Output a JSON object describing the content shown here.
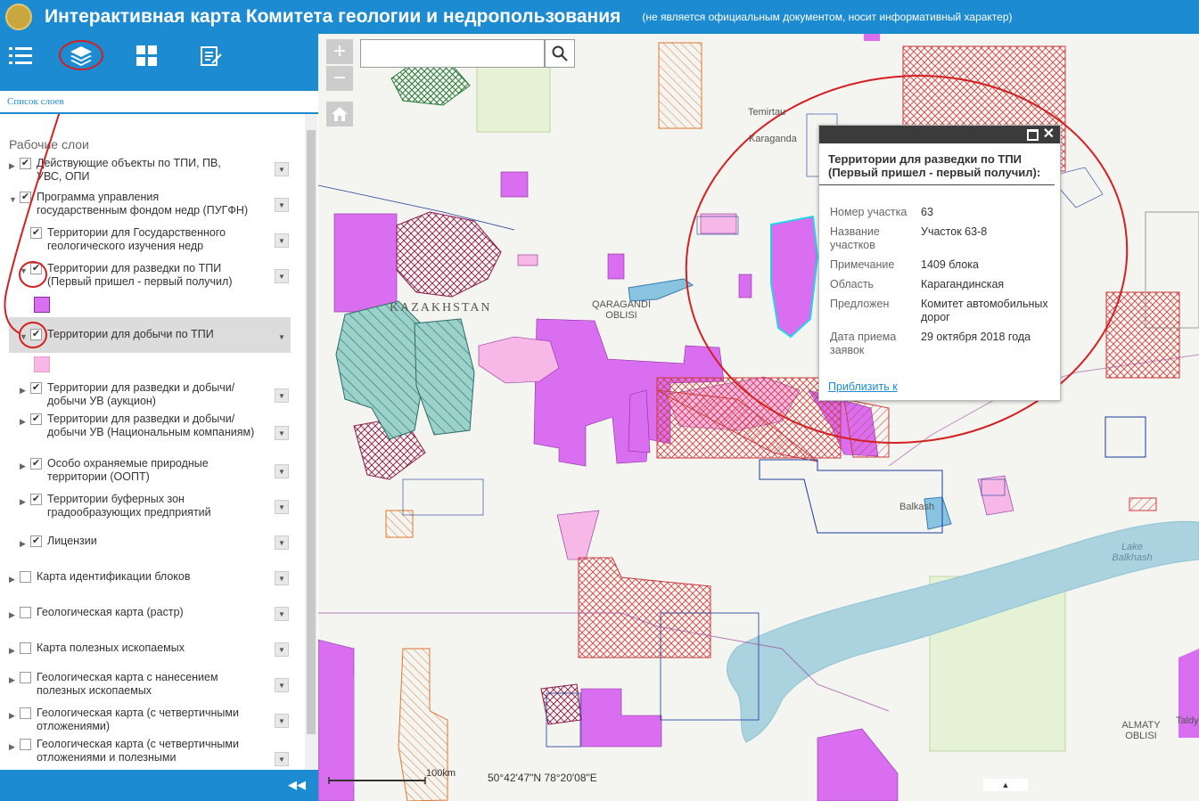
{
  "header": {
    "title": "Интерактивная карта Комитета геологии и недропользования",
    "subtitle": "(не является официальным документом, носит информативный характер)"
  },
  "toolbar": {
    "tools": [
      "list-icon",
      "layers-icon",
      "basemap-gallery-icon",
      "edit-icon"
    ]
  },
  "panel": {
    "tab_label": "Список слоев",
    "section_title": "Рабочие слои"
  },
  "layers": [
    {
      "label": "Действующие объекты по ТПИ, ПВ, УВС, ОПИ",
      "checked": true
    },
    {
      "label": "Программа управления государственным фондом недр (ПУГФН)",
      "checked": true
    },
    {
      "label": "Территории для Государственного геологического изучения недр",
      "checked": true
    },
    {
      "label": "Территории для разведки по ТПИ (Первый пришел - первый получил)",
      "checked": true
    },
    {
      "label": "Территории для добычи по ТПИ",
      "checked": true
    },
    {
      "label": "Территории для разведки и добычи/добычи УВ (аукцион)",
      "checked": true
    },
    {
      "label": "Территории для разведки и добычи/добычи УВ (Национальным компаниям)",
      "checked": true
    },
    {
      "label": "Особо охраняемые природные территории (ООПТ)",
      "checked": true
    },
    {
      "label": "Территории буферных зон градообразующих предприятий",
      "checked": true
    },
    {
      "label": "Лицензии",
      "checked": true
    },
    {
      "label": "Карта идентификации блоков",
      "checked": false
    },
    {
      "label": "Геологическая карта (растр)",
      "checked": false
    },
    {
      "label": "Карта полезных ископаемых",
      "checked": false
    },
    {
      "label": "Геологическая карта с нанесением полезных ископаемых",
      "checked": false
    },
    {
      "label": "Геологическая карта (с четвертичными отложениями)",
      "checked": false
    },
    {
      "label": "Геологическая карта (с четвертичными отложениями и полезными",
      "checked": false
    }
  ],
  "legend_colors": {
    "razvedka": "#d96ef0",
    "dobycha": "#f7b8e8"
  },
  "map": {
    "search_placeholder": "",
    "labels": {
      "country": "KAZAKHSTAN",
      "qaragandi": "QARAGANDI OBLISI",
      "temirtau": "Temirtau",
      "karaganda": "Karaganda",
      "balkash": "Balkash",
      "lake": "Lake Balkhash",
      "almaty": "ALMATY OBLISI",
      "taldy": "Taldy"
    },
    "scale_label": "100km",
    "coordinates": "50°42'47\"N   78°20'08\"E",
    "attribution_btn": "▲"
  },
  "popup": {
    "title": "Территории для разведки по ТПИ (Первый пришел - первый получил):",
    "fields": [
      {
        "key": "Номер участка",
        "value": "63"
      },
      {
        "key": "Название участков",
        "value": "Участок 63-8"
      },
      {
        "key": "Примечание",
        "value": "1409 блока"
      },
      {
        "key": "Область",
        "value": "Карагандинская"
      },
      {
        "key": "Предложен",
        "value": "Комитет автомобильных дорог"
      },
      {
        "key": "Дата приема заявок",
        "value": "29 октября 2018 года"
      }
    ],
    "zoom_link": "Приблизить к"
  },
  "colors": {
    "brand": "#1d8bd1",
    "annotation": "#d42020"
  }
}
